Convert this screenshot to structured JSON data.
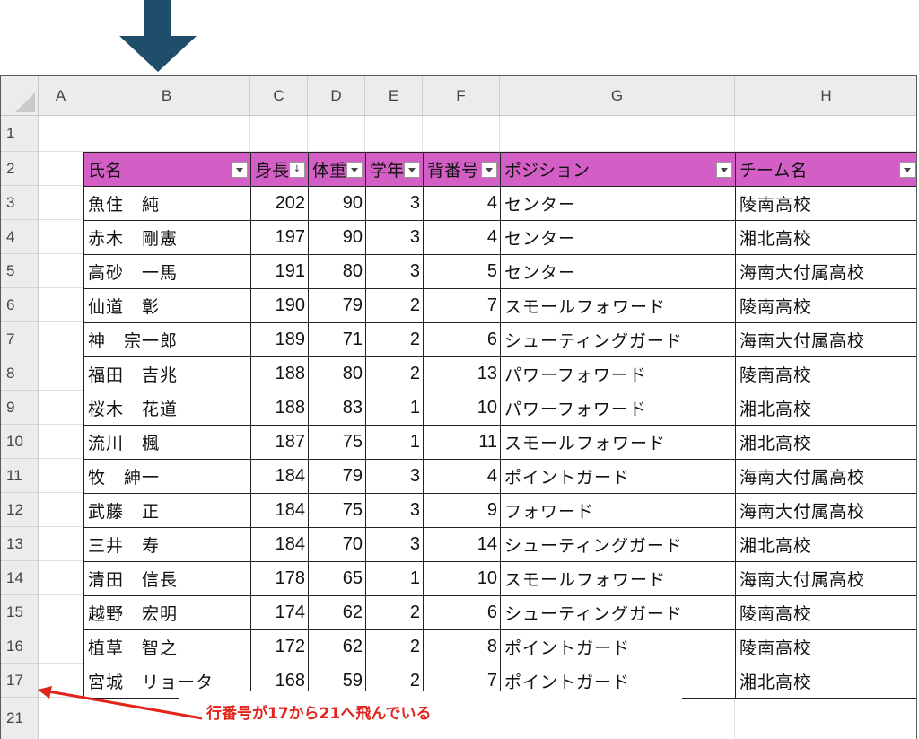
{
  "columns": [
    "A",
    "B",
    "C",
    "D",
    "E",
    "F",
    "G",
    "H"
  ],
  "row_numbers": [
    "1",
    "2",
    "3",
    "4",
    "5",
    "6",
    "7",
    "8",
    "9",
    "10",
    "11",
    "12",
    "13",
    "14",
    "15",
    "16",
    "17",
    "21"
  ],
  "table": {
    "headers": [
      "氏名",
      "身長",
      "体重",
      "学年",
      "背番号",
      "ポジション",
      "チーム名"
    ],
    "sorted_column": "身長",
    "rows": [
      [
        "魚住　純",
        "202",
        "90",
        "3",
        "4",
        "センター",
        "陵南高校"
      ],
      [
        "赤木　剛憲",
        "197",
        "90",
        "3",
        "4",
        "センター",
        "湘北高校"
      ],
      [
        "高砂　一馬",
        "191",
        "80",
        "3",
        "5",
        "センター",
        "海南大付属高校"
      ],
      [
        "仙道　彰",
        "190",
        "79",
        "2",
        "7",
        "スモールフォワード",
        "陵南高校"
      ],
      [
        "神　宗一郎",
        "189",
        "71",
        "2",
        "6",
        "シューティングガード",
        "海南大付属高校"
      ],
      [
        "福田　吉兆",
        "188",
        "80",
        "2",
        "13",
        "パワーフォワード",
        "陵南高校"
      ],
      [
        "桜木　花道",
        "188",
        "83",
        "1",
        "10",
        "パワーフォワード",
        "湘北高校"
      ],
      [
        "流川　楓",
        "187",
        "75",
        "1",
        "11",
        "スモールフォワード",
        "湘北高校"
      ],
      [
        "牧　紳一",
        "184",
        "79",
        "3",
        "4",
        "ポイントガード",
        "海南大付属高校"
      ],
      [
        "武藤　正",
        "184",
        "75",
        "3",
        "9",
        "フォワード",
        "海南大付属高校"
      ],
      [
        "三井　寿",
        "184",
        "70",
        "3",
        "14",
        "シューティングガード",
        "湘北高校"
      ],
      [
        "清田　信長",
        "178",
        "65",
        "1",
        "10",
        "スモールフォワード",
        "海南大付属高校"
      ],
      [
        "越野　宏明",
        "174",
        "62",
        "2",
        "6",
        "シューティングガード",
        "陵南高校"
      ],
      [
        "植草　智之",
        "172",
        "62",
        "2",
        "8",
        "ポイントガード",
        "陵南高校"
      ],
      [
        "宮城　リョータ",
        "168",
        "59",
        "2",
        "7",
        "ポイントガード",
        "湘北高校"
      ]
    ]
  },
  "annotation": "行番号が17から21へ飛んでいる",
  "colors": {
    "header_fill": "#d35fc6",
    "annotation_red": "#e3241b",
    "arrow_blue": "#1f4e6b"
  }
}
